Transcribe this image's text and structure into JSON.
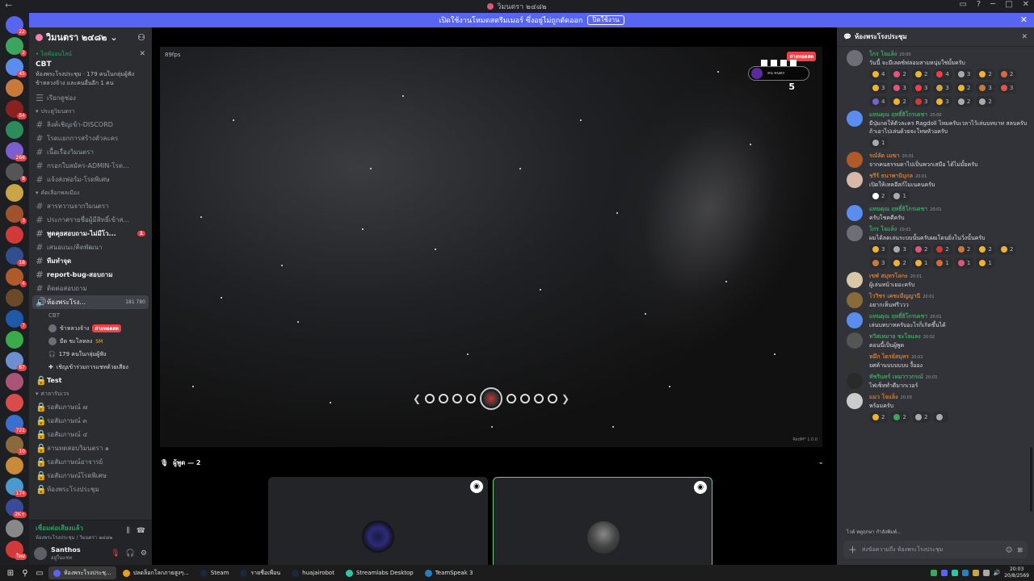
{
  "window": {
    "title": "วิมนตรา ๒๔๘๒",
    "controls": [
      "▭",
      "?",
      "─",
      "□",
      "✕"
    ]
  },
  "banner": {
    "text": "เปิดใช้งานโหมดสตรีมเมอร์ ซึ่งอยู่ไม่ถูกตัดออก",
    "button": "ปิดใช้งาน",
    "close": "✕"
  },
  "guild_bar": {
    "items": [
      {
        "name": "home",
        "color": "#5865f2",
        "badge": "22"
      },
      {
        "name": "server-1",
        "color": "#3ba55d",
        "badge": "2"
      },
      {
        "name": "server-2",
        "color": "#5b8def",
        "badge": "45"
      },
      {
        "name": "server-3",
        "color": "#c97a3b",
        "badge": ""
      },
      {
        "name": "server-4",
        "color": "#8b2020",
        "badge": "54"
      },
      {
        "name": "server-5",
        "color": "#2d8a5a",
        "badge": ""
      },
      {
        "name": "server-6",
        "color": "#7b5fd1",
        "badge": "266"
      },
      {
        "name": "server-7",
        "color": "#555",
        "badge": "8"
      },
      {
        "name": "server-8",
        "color": "#c9a54a",
        "badge": ""
      },
      {
        "name": "server-9",
        "color": "#a0522d",
        "badge": "3"
      },
      {
        "name": "server-10",
        "color": "#d23a3a",
        "badge": ""
      },
      {
        "name": "server-11",
        "color": "#2f4f8f",
        "badge": "18"
      },
      {
        "name": "server-12",
        "color": "#b05a2a",
        "badge": "4"
      },
      {
        "name": "server-13",
        "color": "#6b4a2a",
        "badge": ""
      },
      {
        "name": "server-14",
        "color": "#1e5aa8",
        "badge": "7"
      },
      {
        "name": "server-15",
        "color": "#3aaa4a",
        "badge": ""
      },
      {
        "name": "server-16",
        "color": "#6b8fd1",
        "badge": "87"
      },
      {
        "name": "server-17",
        "color": "#aa5577",
        "badge": ""
      },
      {
        "name": "server-18",
        "color": "#d94c4c",
        "badge": ""
      },
      {
        "name": "server-19",
        "color": "#3a6fcf",
        "badge": "721"
      },
      {
        "name": "server-20",
        "color": "#8a6a3a",
        "badge": "10"
      },
      {
        "name": "server-21",
        "color": "#c98a3a",
        "badge": ""
      },
      {
        "name": "server-22",
        "color": "#4a9acf",
        "badge": "174"
      },
      {
        "name": "server-23",
        "color": "#3a4a9a",
        "badge": "2K+"
      },
      {
        "name": "server-24",
        "color": "#888",
        "badge": ""
      },
      {
        "name": "server-25",
        "color": "#d23a3a",
        "badge": "ใหม่"
      }
    ]
  },
  "sidebar": {
    "server_name": "วิมนตรา ๒๔๘๒",
    "online": {
      "label": "• ไลฟ์ออนไลน์",
      "title": "CBT",
      "line1": "ห้องพระโรงประชุม · 179 คนในกลุ่มผู้ฟัง",
      "line2": "ข้าหลวงจ้าง  และคนอื่นอีก 1 คน"
    },
    "browse": "เรียกดูช่อง",
    "cat1": "ประตูวิมนตรา",
    "channels1": [
      "ลิงค์เชิญเข้า-DISCORD",
      "โรดแยกการสร้างตัวละคร",
      "เนื้อเรื่องวิมนตรา",
      "กรอกใบสมัคร-ADMIN-โรด...",
      "แจ้งส่งฟอร์ม-โรดพิเศษ"
    ],
    "cat2": "คัดเลือกพลเมือง",
    "channels2": [
      "สารหวานจากวิมนตรา",
      "ประกาศรายชื่อผู้มีสิทธิ์เข้าส...",
      "พูดคุยสอบถาม-ไม่มีโว...",
      "เสนอแนะ/คิดพัฒนา",
      "ทีมทำจุด",
      "report-bug-สอบถาม",
      "ติดต่อสอบถาม"
    ],
    "channels2_badge": "1",
    "voice_active": "ห้องพระโรง...",
    "voice_counts": "181  780",
    "voice_sub": "CBT",
    "voice_user1": "ข้าหลวงจ้าง",
    "voice_user1_live": "ถ่ายทอดสด",
    "voice_user2": "มีด ชะโลหลง",
    "voice_user2_tag": "SM",
    "voice_listeners": "179 คนในกลุ่มผู้ฟัง",
    "voice_invite": "เชิญเข้าร่วมการแชทด้วยเสียง",
    "test": "Test",
    "cat3": "ศาลารับเวร",
    "channels3": [
      "รอสัมภาษณ์ ๗",
      "รอสัมภาษณ์ ๓",
      "รอสัมภาษณ์ ๔",
      "ลานทดสอบวิมนตรา ๑",
      "รอสัมภาษณ์อาจารย์",
      "รอสัมภาษณ์โรดพิเศษ",
      "ห้องพระโรงประชุม"
    ],
    "vc_status": "เชื่อมต่อเสียงแล้ว",
    "vc_sub": "ห้องพระโรงประชุม / วิมนตรา ๒๔๘๒",
    "user_name": "Santhos",
    "user_status": "อยู่ในแชท"
  },
  "stage": {
    "fps": "89fps",
    "live": "ถ่ายทอดสด",
    "hud_text": "คน คนตก",
    "hud_number": "5",
    "watermark": "RedM* 1.0.0",
    "participants": "ผู้พูด — 2"
  },
  "chat": {
    "channel": "ห้องพระโรงประชุม",
    "messages": [
      {
        "name": "โกร โจแล็ง",
        "color": "#3ba55d",
        "time": "20:00",
        "text": "วันนี้ จะมีเลดซ์ฟลอมสามหนุ่มใช่มั้ยครับ",
        "avatar": "#6d6f78",
        "reacts": [
          [
            "#f0b232",
            "4"
          ],
          [
            "#e0557c",
            "2"
          ],
          [
            "#f0b232",
            "2"
          ],
          [
            "#f23f43",
            "4"
          ],
          [
            "#aaa",
            "3"
          ],
          [
            "#f0b232",
            "2"
          ],
          [
            "#d96a3a",
            "2"
          ],
          [
            "#f0b232",
            "3"
          ],
          [
            "#e0557c",
            "3"
          ],
          [
            "#f23f43",
            "3"
          ],
          [
            "#c9a54a",
            "3"
          ],
          [
            "#f0b232",
            "2"
          ],
          [
            "#c97a3b",
            "3"
          ],
          [
            "#e05550",
            "3"
          ],
          [
            "#7b5fd1",
            "4"
          ],
          [
            "#f0b232",
            "2"
          ],
          [
            "#d23a3a",
            "3"
          ],
          [
            "#f0b232",
            "3"
          ],
          [
            "#aaa",
            "2"
          ],
          [
            "#aaa",
            "2"
          ]
        ]
      },
      {
        "name": "แทนดุณ ฤทธิ์ธิโกรเดชา",
        "color": "#3ba55d",
        "time": "20:00",
        "text": "มีปุ่มกดให้ตัวละคร Ragdoll ไหมครับเวลาไว้เล่นบทบาท สลบครับ ถ้าเอาไปเล่นด้วยจะโทษหัวอครับ",
        "avatar": "#5b8def",
        "reacts": [
          [
            "#aaa",
            "1"
          ]
        ]
      },
      {
        "name": "รณ์ลัต เมฆา",
        "color": "#c97a3b",
        "time": "20:01",
        "text": "จากคนธรรมดาไปเป็นพวกเสมือ ได้ไม่มั้ยครับ",
        "avatar": "#b05a2a",
        "reacts": []
      },
      {
        "name": "ชรีร์ ธนาพานิบุกล",
        "color": "#c97a3b",
        "time": "20:01",
        "text": "เปิดให้เทคอีสก์ไมเนคนครับ",
        "avatar": "#d9b8a8",
        "reacts": [
          [
            "#fff",
            "2"
          ],
          [
            "#aaa",
            "1"
          ]
        ]
      },
      {
        "name": "แทนดุณ ฤทธิ์ธิโกรเดชา",
        "color": "#3ba55d",
        "time": "20:01",
        "text": "ครับโชคดีครับ",
        "avatar": "#5b8def",
        "reacts": []
      },
      {
        "name": "โกร โจแล็ง",
        "color": "#3ba55d",
        "time": "20:01",
        "text": "ผมได้ลดเล่นระบบนั้นครับผมโดนยิ่งโนวิ่งนั้นครับ",
        "avatar": "#6d6f78",
        "reacts": [
          [
            "#f0b232",
            "3"
          ],
          [
            "#aaa",
            "3"
          ],
          [
            "#e0557c",
            "2"
          ],
          [
            "#d23a3a",
            "2"
          ],
          [
            "#c97a3b",
            "2"
          ],
          [
            "#f0b232",
            "2"
          ],
          [
            "#f0b232",
            "2"
          ],
          [
            "#c97a3b",
            "3"
          ],
          [
            "#f0b232",
            "2"
          ],
          [
            "#f0b232",
            "1"
          ],
          [
            "#d96a3a",
            "1"
          ],
          [
            "#e0557c",
            "1"
          ],
          [
            "#f0b232",
            "1"
          ]
        ]
      },
      {
        "name": "เขฬ สมุทรโลกะ",
        "color": "#c97a3b",
        "time": "20:01",
        "text": "ผู้เล่นหน้าเยอะครับ",
        "avatar": "#d9c8a8",
        "reacts": []
      },
      {
        "name": "ไววิชร เคชะมีญญานี",
        "color": "#c97a3b",
        "time": "20:01",
        "text": "อยากเห็นฟรีววว",
        "avatar": "#8a6a3a",
        "reacts": []
      },
      {
        "name": "แทนดุณ ฤทธิ์ธิโกรเดชา",
        "color": "#3ba55d",
        "time": "20:01",
        "text": "เล่นบทบาทครับอะไรก็เกิดขึ้นได้",
        "avatar": "#5b8def",
        "reacts": []
      },
      {
        "name": "ทวิสเหมาย ชะโลแลง",
        "color": "#3ba55d",
        "time": "20:02",
        "text": "ตอนนี้เป็นผู้พูด",
        "avatar": "#555",
        "reacts": []
      },
      {
        "name": "หมึก ไดรย์สมุทร",
        "color": "#c97a3b",
        "time": "20:02",
        "text": "ยศค้านบบบบบบ งื้ออง",
        "avatar": "#333",
        "reacts": []
      },
      {
        "name": "ทัชรินทร์ เหมวาวกรณ์",
        "color": "#3ba55d",
        "time": "20:03",
        "text": "ไฟเซ็ทท่ำดีมากเวอร์",
        "avatar": "#2a2a2a",
        "reacts": []
      },
      {
        "name": "แมว โจแล็ง",
        "color": "#c97a3b",
        "time": "20:03",
        "text": "พร้อมครับ",
        "avatar": "#ccc",
        "reacts": [
          [
            "#f0b232",
            "2"
          ],
          [
            "#3ba55d",
            "2"
          ],
          [
            "#aaa",
            "2"
          ],
          [
            "#aaa",
            ""
          ]
        ]
      }
    ],
    "typing": "ไวต์ ทตูฤกษา กำลังพิมพ์...",
    "input_placeholder": "ส่งข้อความถึง ห้องพระโรงประชุม"
  },
  "taskbar": {
    "apps": [
      {
        "label": "ห้องพระโรงประชุ...",
        "color": "#5865f2",
        "active": true
      },
      {
        "label": "ปลดล็อกโลกภายสูงๆ...",
        "color": "#e0a020",
        "active": false
      },
      {
        "label": "Steam",
        "color": "#1b2838",
        "active": false
      },
      {
        "label": "รายชื่อเพื่อน",
        "color": "#1b2838",
        "active": false
      },
      {
        "label": "huajairobot",
        "color": "#1b2838",
        "active": false
      },
      {
        "label": "Streamlabs Desktop",
        "color": "#31c3a2",
        "active": false
      },
      {
        "label": "TeamSpeak 3",
        "color": "#2580c3",
        "active": false
      }
    ],
    "time": "20:03",
    "date": "20/8/2569"
  }
}
